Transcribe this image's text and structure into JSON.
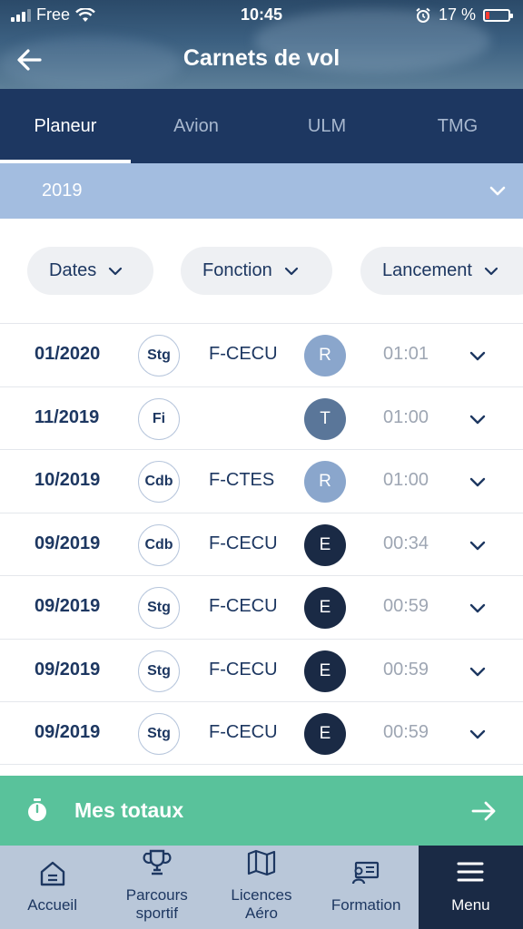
{
  "status_bar": {
    "carrier": "Free",
    "time": "10:45",
    "battery_percent": "17 %"
  },
  "header": {
    "title": "Carnets de vol"
  },
  "tabs": [
    {
      "label": "Planeur",
      "active": true
    },
    {
      "label": "Avion",
      "active": false
    },
    {
      "label": "ULM",
      "active": false
    },
    {
      "label": "TMG",
      "active": false
    }
  ],
  "year_selector": {
    "value": "2019"
  },
  "filters": [
    {
      "label": "Dates"
    },
    {
      "label": "Fonction"
    },
    {
      "label": "Lancement"
    }
  ],
  "flights": [
    {
      "date": "01/2020",
      "function": "Stg",
      "registration": "F-CECU",
      "launch": "R",
      "duration": "01:01"
    },
    {
      "date": "11/2019",
      "function": "Fi",
      "registration": "",
      "launch": "T",
      "duration": "01:00"
    },
    {
      "date": "10/2019",
      "function": "Cdb",
      "registration": "F-CTES",
      "launch": "R",
      "duration": "01:00"
    },
    {
      "date": "09/2019",
      "function": "Cdb",
      "registration": "F-CECU",
      "launch": "E",
      "duration": "00:34"
    },
    {
      "date": "09/2019",
      "function": "Stg",
      "registration": "F-CECU",
      "launch": "E",
      "duration": "00:59"
    },
    {
      "date": "09/2019",
      "function": "Stg",
      "registration": "F-CECU",
      "launch": "E",
      "duration": "00:59"
    },
    {
      "date": "09/2019",
      "function": "Stg",
      "registration": "F-CECU",
      "launch": "E",
      "duration": "00:59"
    }
  ],
  "launch_colors": {
    "R": "#8aa6cc",
    "T": "#5a7699",
    "E": "#1a2a45"
  },
  "totals": {
    "label": "Mes totaux"
  },
  "bottom_nav": [
    {
      "label": "Accueil",
      "icon": "home-icon",
      "active": false
    },
    {
      "label": "Parcours sportif",
      "icon": "trophy-icon",
      "active": false
    },
    {
      "label": "Licences Aéro",
      "icon": "map-icon",
      "active": false
    },
    {
      "label": "Formation",
      "icon": "certificate-icon",
      "active": false
    },
    {
      "label": "Menu",
      "icon": "menu-icon",
      "active": true
    }
  ],
  "colors": {
    "primary": "#1d3761",
    "accent_green": "#59c29b",
    "year_bar": "#a3bde0",
    "nav_bg": "#b9c7d9"
  }
}
